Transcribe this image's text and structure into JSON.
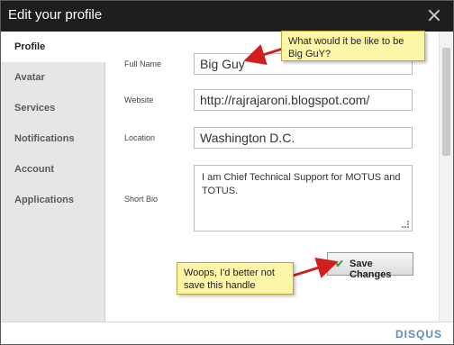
{
  "window": {
    "title": "Edit your profile"
  },
  "sidebar": {
    "items": [
      {
        "label": "Profile"
      },
      {
        "label": "Avatar"
      },
      {
        "label": "Services"
      },
      {
        "label": "Notifications"
      },
      {
        "label": "Account"
      },
      {
        "label": "Applications"
      }
    ],
    "active": "Profile"
  },
  "form": {
    "full_name": {
      "label": "Full Name",
      "value": "Big Guy"
    },
    "website": {
      "label": "Website",
      "value": "http://rajrajaroni.blogspot.com/"
    },
    "location": {
      "label": "Location",
      "value": "Washington D.C."
    },
    "short_bio": {
      "label": "Short Bio",
      "value": "I am Chief Technical Support for MOTUS and TOTUS."
    },
    "save_label": "Save Changes"
  },
  "annotations": {
    "callout_top": "What would it be like to be Big GuY?",
    "callout_bottom": "Woops, I'd better not save this handle"
  },
  "footer": {
    "brand": "DISQUS"
  },
  "colors": {
    "titlebar": "#1e1e1e",
    "sidebar": "#e6e6e6",
    "callout": "#fdf6a9",
    "arrow": "#d11f1f",
    "brand": "#5b8cc5"
  }
}
